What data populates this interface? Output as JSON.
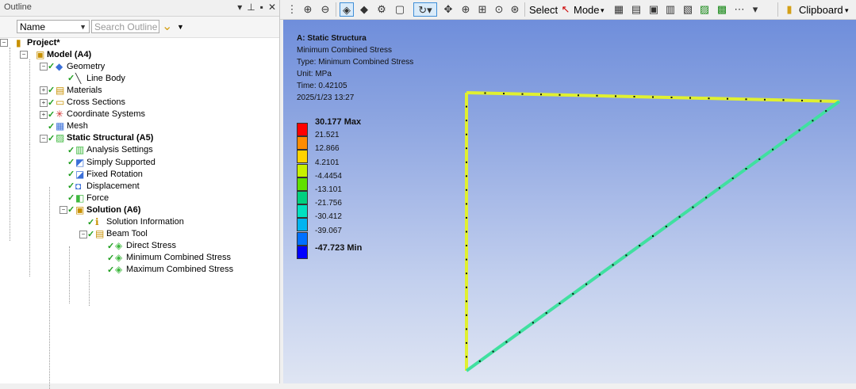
{
  "outline": {
    "title": "Outline",
    "pin_icon": "pin-icon",
    "close_icon": "close-icon",
    "filter_select": "Name",
    "search_placeholder": "Search Outline"
  },
  "tree": [
    {
      "id": "project",
      "label": "Project*",
      "bold": true,
      "icon": "project-icon",
      "check": false
    },
    {
      "id": "model",
      "label": "Model (A4)",
      "bold": true,
      "icon": "model-icon",
      "check": false
    },
    {
      "id": "geometry",
      "label": "Geometry",
      "bold": false,
      "icon": "geometry-icon",
      "check": true
    },
    {
      "id": "line-body",
      "label": "Line Body",
      "bold": false,
      "icon": "line-body-icon",
      "check": true
    },
    {
      "id": "materials",
      "label": "Materials",
      "bold": false,
      "icon": "materials-icon",
      "check": true
    },
    {
      "id": "cross-sections",
      "label": "Cross Sections",
      "bold": false,
      "icon": "cross-sections-icon",
      "check": true
    },
    {
      "id": "coordinate-systems",
      "label": "Coordinate Systems",
      "bold": false,
      "icon": "coordinate-systems-icon",
      "check": true
    },
    {
      "id": "mesh",
      "label": "Mesh",
      "bold": false,
      "icon": "mesh-icon",
      "check": true
    },
    {
      "id": "static-structural",
      "label": "Static Structural (A5)",
      "bold": true,
      "icon": "static-structural-icon",
      "check": true
    },
    {
      "id": "analysis-settings",
      "label": "Analysis Settings",
      "bold": false,
      "icon": "analysis-settings-icon",
      "check": true
    },
    {
      "id": "simply-supported",
      "label": "Simply Supported",
      "bold": false,
      "icon": "simply-supported-icon",
      "check": true
    },
    {
      "id": "fixed-rotation",
      "label": "Fixed Rotation",
      "bold": false,
      "icon": "fixed-rotation-icon",
      "check": true
    },
    {
      "id": "displacement",
      "label": "Displacement",
      "bold": false,
      "icon": "displacement-icon",
      "check": true
    },
    {
      "id": "force",
      "label": "Force",
      "bold": false,
      "icon": "force-icon",
      "check": true
    },
    {
      "id": "solution",
      "label": "Solution (A6)",
      "bold": true,
      "icon": "solution-icon",
      "check": true
    },
    {
      "id": "solution-information",
      "label": "Solution Information",
      "bold": false,
      "icon": "solution-information-icon",
      "check": true
    },
    {
      "id": "beam-tool",
      "label": "Beam Tool",
      "bold": false,
      "icon": "beam-tool-icon",
      "check": true
    },
    {
      "id": "direct-stress",
      "label": "Direct Stress",
      "bold": false,
      "icon": "result-icon",
      "check": true
    },
    {
      "id": "minimum-combined-stress",
      "label": "Minimum Combined Stress",
      "bold": false,
      "icon": "result-icon",
      "check": true
    },
    {
      "id": "maximum-combined-stress",
      "label": "Maximum Combined Stress",
      "bold": false,
      "icon": "result-icon",
      "check": true
    }
  ],
  "toolbar": {
    "select_label": "Select",
    "mode_label": "Mode",
    "clipboard_label": "Clipboard",
    "icons": [
      "zoom-fit-icon",
      "zoom-box-icon",
      "iso-view-icon",
      "solid-icon",
      "pan-icon",
      "rotate-icon",
      "zoom-in-icon",
      "zoom-out-icon",
      "zoom-region-icon"
    ]
  },
  "viewport": {
    "header": "A: Static Structura",
    "result_name": "Minimum Combined Stress",
    "type_line": "Type: Minimum Combined Stress",
    "unit_line": "Unit: MPa",
    "time_line": "Time: 0.42105",
    "date_line": "2025/1/23 13:27"
  },
  "legend": [
    {
      "label": "30.177 Max",
      "color": "#ff0000",
      "bold": true
    },
    {
      "label": "21.521",
      "color": "#ff8c00",
      "bold": false
    },
    {
      "label": "12.866",
      "color": "#ffd300",
      "bold": false
    },
    {
      "label": "4.2101",
      "color": "#c8f000",
      "bold": false
    },
    {
      "label": "-4.4454",
      "color": "#60e000",
      "bold": false
    },
    {
      "label": "-13.101",
      "color": "#00d080",
      "bold": false
    },
    {
      "label": "-21.756",
      "color": "#00e0c0",
      "bold": false
    },
    {
      "label": "-30.412",
      "color": "#00b4f0",
      "bold": false
    },
    {
      "label": "-39.067",
      "color": "#0070ff",
      "bold": false
    },
    {
      "label": "-47.723 Min",
      "color": "#0000ff",
      "bold": true
    }
  ],
  "beam_colors": {
    "left": "#e0f030",
    "top": "#e0f030",
    "diagonal": "#40e0a0"
  }
}
